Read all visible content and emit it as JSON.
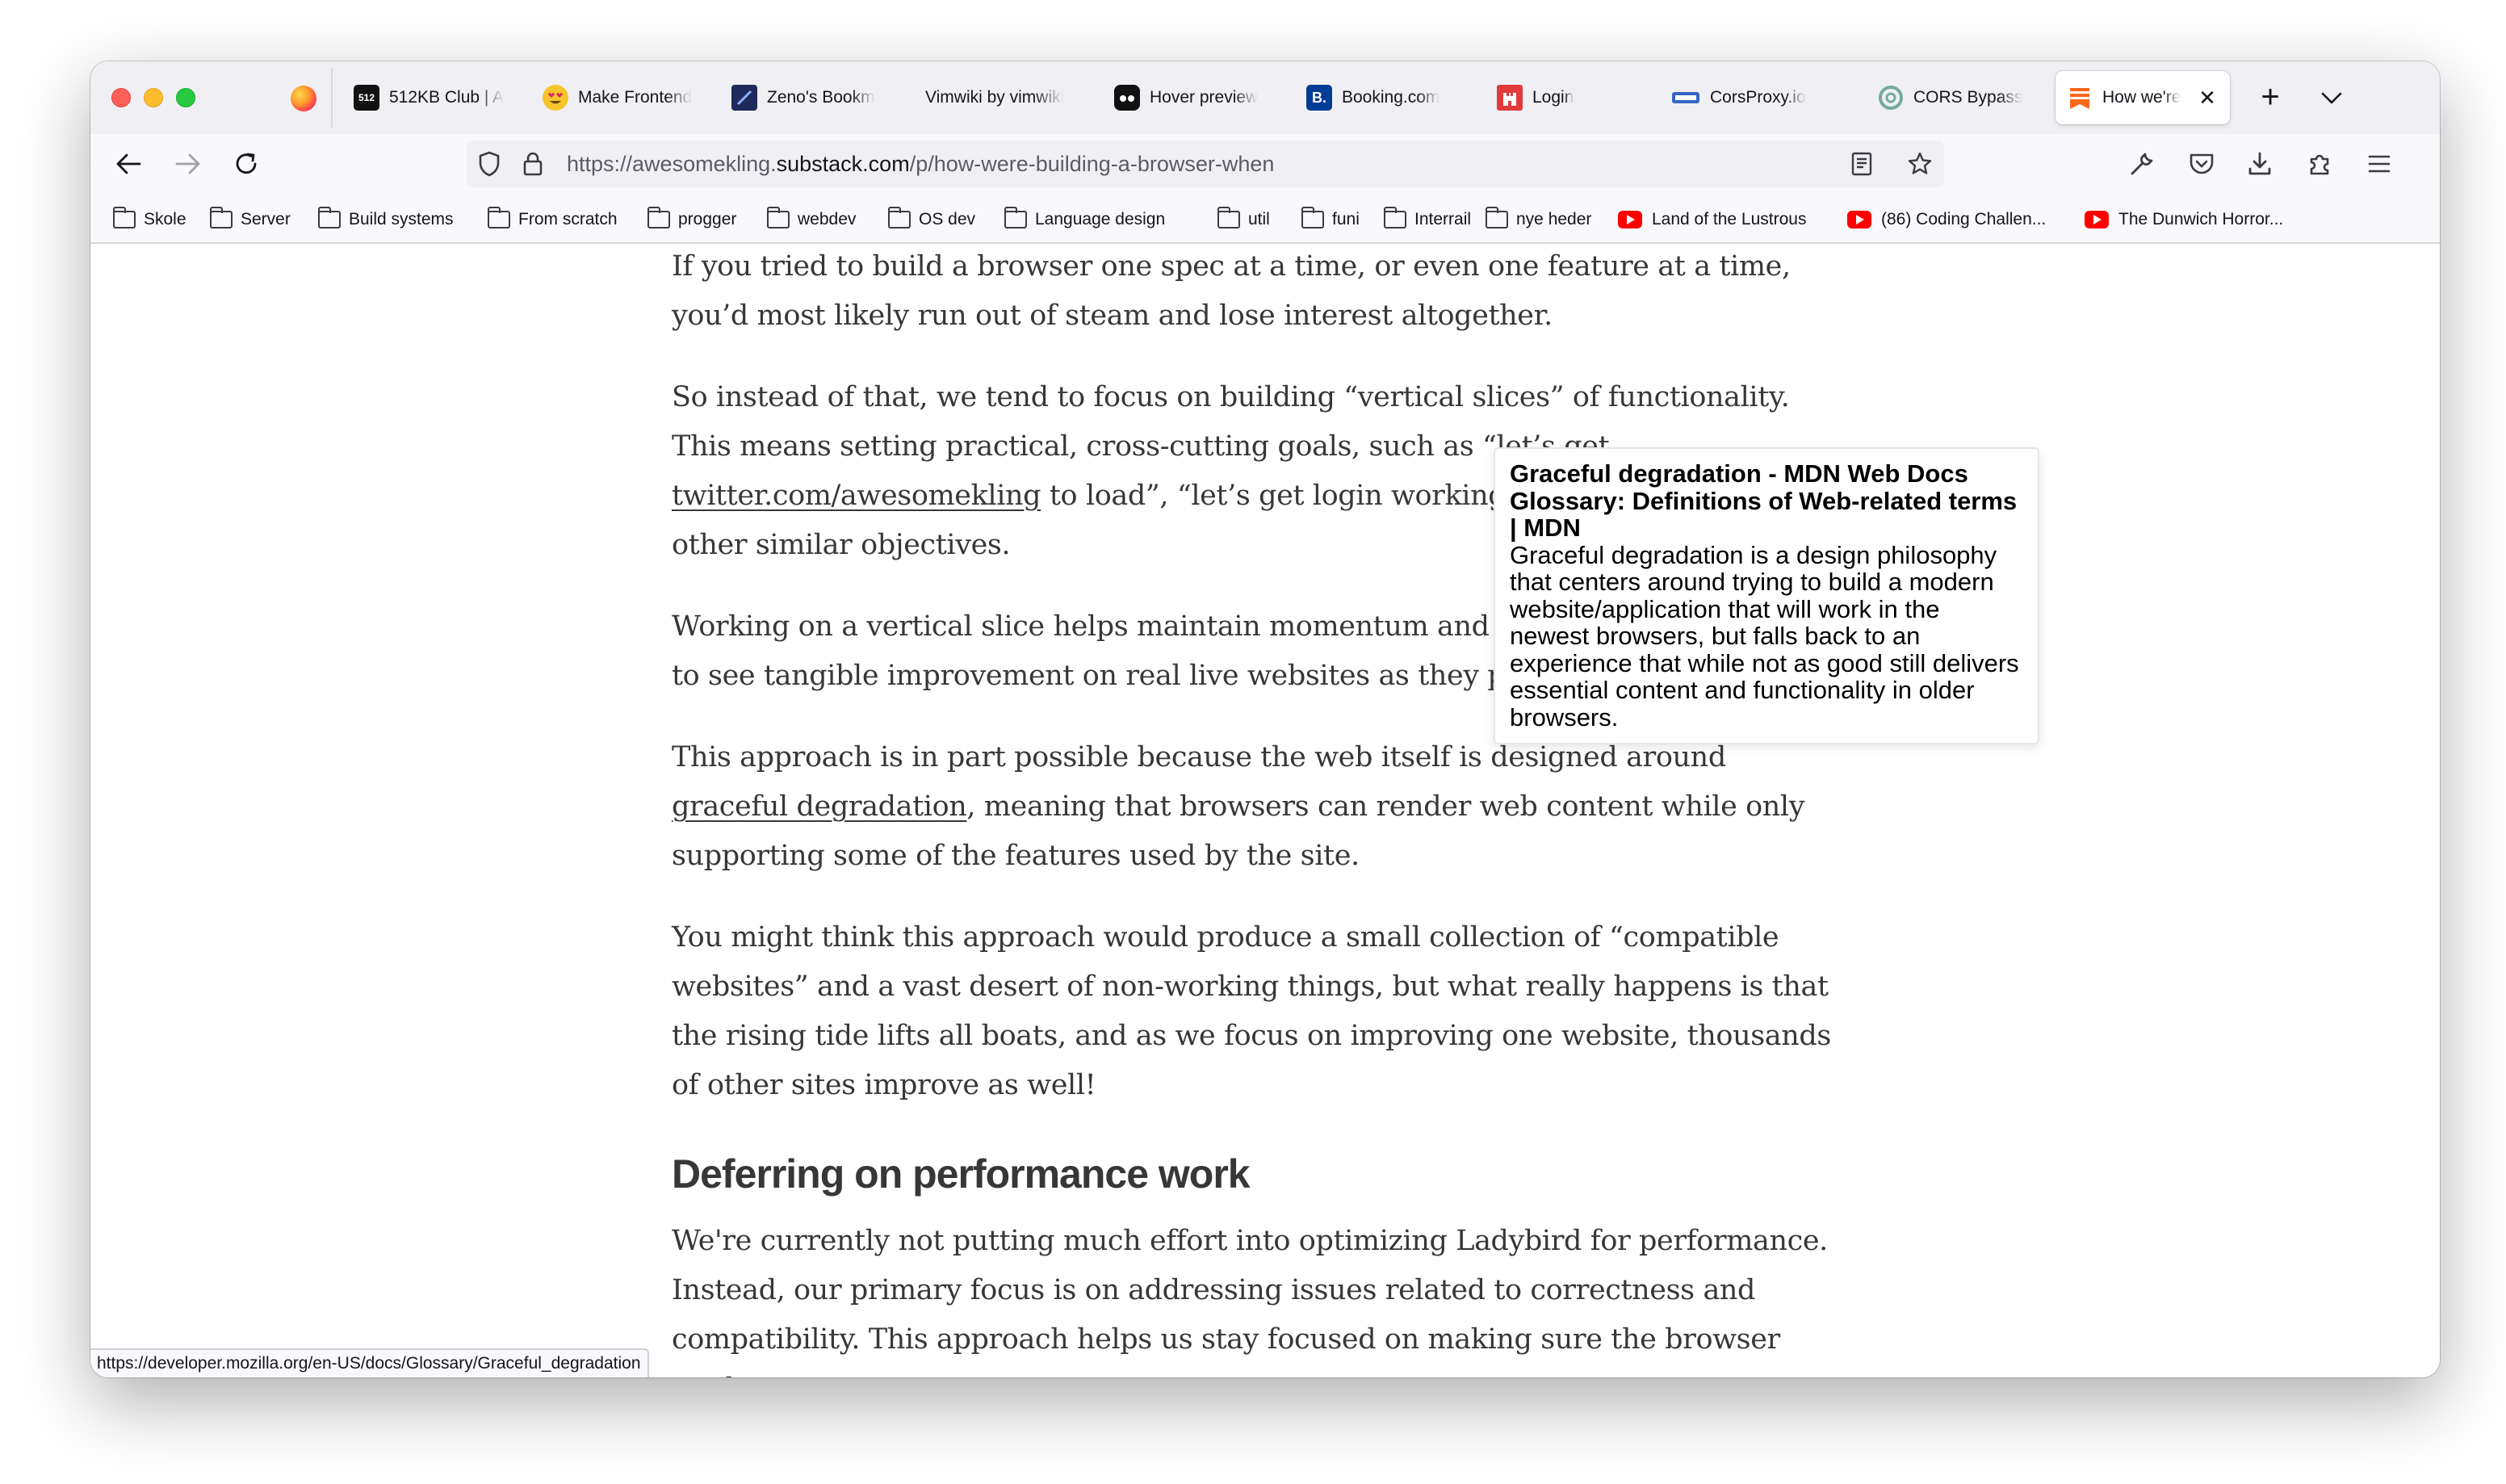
{
  "tabs": [
    {
      "title": "512KB Club | A",
      "favicon": "512-icon",
      "fav_text": "512",
      "fav_color": "#111111"
    },
    {
      "title": "Make Frontend",
      "favicon": "heart-eyes-emoji-icon",
      "fav_text": "",
      "fav_color": "#f7c52b"
    },
    {
      "title": "Zeno's Bookm",
      "favicon": "zeno-icon",
      "fav_text": "",
      "fav_color": "#1d2a5b"
    },
    {
      "title": "Vimwiki by vimwiki",
      "favicon": "",
      "fav_text": "",
      "fav_color": ""
    },
    {
      "title": "Hover preview",
      "favicon": "github-icon",
      "fav_text": "",
      "fav_color": "#111111"
    },
    {
      "title": "Booking.com",
      "favicon": "booking-icon",
      "fav_text": "B.",
      "fav_color": "#003b95"
    },
    {
      "title": "Login",
      "favicon": "castle-icon",
      "fav_text": "",
      "fav_color": "#e23a3a"
    },
    {
      "title": "CorsProxy.io",
      "favicon": "corsproxy-icon",
      "fav_text": "",
      "fav_color": "#3565c4"
    },
    {
      "title": "CORS Bypass",
      "favicon": "chatgpt-icon",
      "fav_text": "",
      "fav_color": "#74aa9c"
    },
    {
      "title": "How we're",
      "favicon": "substack-icon",
      "fav_text": "",
      "fav_color": "#ff6719"
    }
  ],
  "active_tab_index": 9,
  "url": {
    "prefix": "https://awesomekling.",
    "host": "substack.com",
    "path": "/p/how-were-building-a-browser-when"
  },
  "bookmarks": [
    {
      "label": "Skole",
      "type": "folder"
    },
    {
      "label": "Server",
      "type": "folder"
    },
    {
      "label": "Build systems",
      "type": "folder"
    },
    {
      "label": "From scratch",
      "type": "folder"
    },
    {
      "label": "progger",
      "type": "folder"
    },
    {
      "label": "webdev",
      "type": "folder"
    },
    {
      "label": "OS dev",
      "type": "folder"
    },
    {
      "label": "Language design",
      "type": "folder"
    },
    {
      "label": "util",
      "type": "folder"
    },
    {
      "label": "funi",
      "type": "folder"
    },
    {
      "label": "Interrail",
      "type": "folder"
    },
    {
      "label": "nye heder",
      "type": "folder"
    },
    {
      "label": "Land of the Lustrous",
      "type": "youtube"
    },
    {
      "label": "(86) Coding Challen...",
      "type": "youtube"
    },
    {
      "label": "The Dunwich Horror...",
      "type": "youtube"
    }
  ],
  "article": {
    "p1": "If you tried to build a browser one spec at a time, or even one feature at a time, you’d most likely run out of steam and lose interest altogether.",
    "p2_before": "So instead of that, we tend to focus on building “vertical slices” of functionality. This means setting practical, cross-cutting goals, such as “let’s get ",
    "p2_link": "twitter.com/awesomekling",
    "p2_after": " to load”, “let’s get login working on discord.com”, and other similar objectives.",
    "p3": "Working on a vertical slice helps maintain momentum and it’s extremely motivating to see tangible improvement on real live websites as they progress.",
    "p4_before": "This approach is in part possible because the web itself is designed around ",
    "p4_link": "graceful degradation",
    "p4_after": ", meaning that browsers can render web content while only supporting some of the features used by the site.",
    "p5": "You might think this approach would produce a small collection of “compatible websites” and a vast desert of non-working things, but what really happens is that the rising tide lifts all boats, and as we focus on improving one website, thousands of other sites improve as well!",
    "h2": "Deferring on performance work",
    "p6": "We're currently not putting much effort into optimizing Ladybird for performance. Instead, our primary focus is on addressing issues related to correctness and compatibility. This approach helps us stay focused on making sure the browser works"
  },
  "tooltip": {
    "title": "Graceful degradation - MDN Web Docs Glossary: Definitions of Web-related terms | MDN",
    "body": "Graceful degradation is a design philosophy that centers around trying to build a modern website/application that will work in the newest browsers, but falls back to an experience that while not as good still delivers essential content and functionality in older browsers."
  },
  "status_url": "https://developer.mozilla.org/en-US/docs/Glossary/Graceful_degradation"
}
